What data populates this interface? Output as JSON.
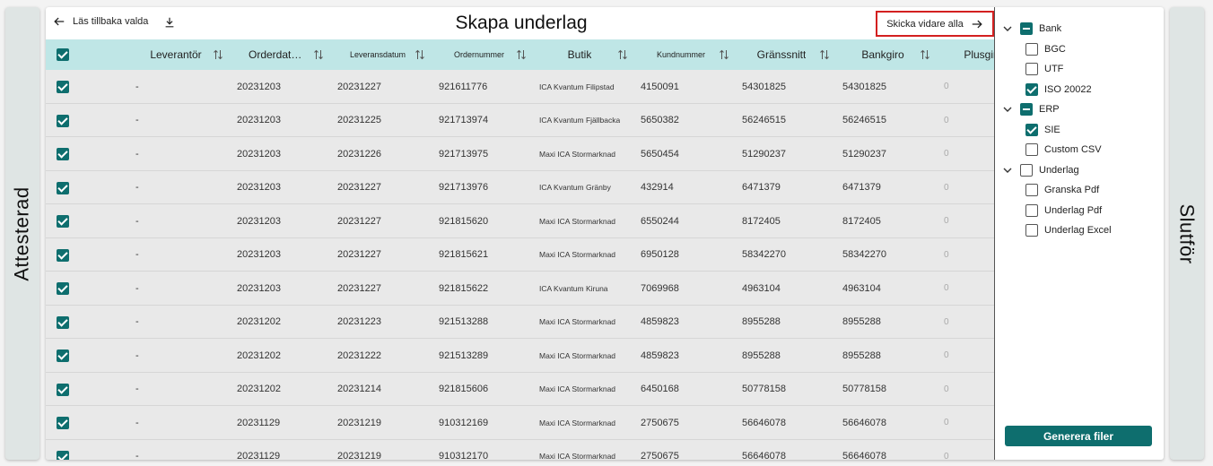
{
  "left_panel": {
    "label": "Attesterad"
  },
  "right_panel": {
    "label": "Slutför"
  },
  "toolbar": {
    "back_label": "Läs tillbaka valda",
    "title": "Skapa underlag",
    "forward_label": "Skicka vidare alla"
  },
  "table": {
    "columns": [
      {
        "label": "Leverantör",
        "sortable": true
      },
      {
        "label": "Orderdatum",
        "sortable": true
      },
      {
        "label": "Leveransdatum",
        "sortable": true
      },
      {
        "label": "Ordernummer",
        "sortable": true
      },
      {
        "label": "Butik",
        "sortable": true
      },
      {
        "label": "Kundnummer",
        "sortable": true
      },
      {
        "label": "Gränssnitt",
        "sortable": true
      },
      {
        "label": "Bankgiro",
        "sortable": true
      },
      {
        "label": "Plusgiro",
        "sortable": true
      }
    ],
    "rows": [
      {
        "checked": true,
        "cells": [
          "-",
          "20231203",
          "20231227",
          "921611776",
          "ICA Kvantum Filipstad",
          "4150091",
          "54301825",
          "54301825",
          "0"
        ]
      },
      {
        "checked": true,
        "cells": [
          "-",
          "20231203",
          "20231225",
          "921713974",
          "ICA Kvantum Fjällbacka",
          "5650382",
          "56246515",
          "56246515",
          "0"
        ]
      },
      {
        "checked": true,
        "cells": [
          "-",
          "20231203",
          "20231226",
          "921713975",
          "Maxi ICA Stormarknad",
          "5650454",
          "51290237",
          "51290237",
          "0"
        ]
      },
      {
        "checked": true,
        "cells": [
          "-",
          "20231203",
          "20231227",
          "921713976",
          "ICA Kvantum Gränby",
          "432914",
          "6471379",
          "6471379",
          "0"
        ]
      },
      {
        "checked": true,
        "cells": [
          "-",
          "20231203",
          "20231227",
          "921815620",
          "Maxi ICA Stormarknad",
          "6550244",
          "8172405",
          "8172405",
          "0"
        ]
      },
      {
        "checked": true,
        "cells": [
          "-",
          "20231203",
          "20231227",
          "921815621",
          "Maxi ICA Stormarknad",
          "6950128",
          "58342270",
          "58342270",
          "0"
        ]
      },
      {
        "checked": true,
        "cells": [
          "-",
          "20231203",
          "20231227",
          "921815622",
          "ICA Kvantum Kiruna",
          "7069968",
          "4963104",
          "4963104",
          "0"
        ]
      },
      {
        "checked": true,
        "cells": [
          "-",
          "20231202",
          "20231223",
          "921513288",
          "Maxi ICA Stormarknad",
          "4859823",
          "8955288",
          "8955288",
          "0"
        ]
      },
      {
        "checked": true,
        "cells": [
          "-",
          "20231202",
          "20231222",
          "921513289",
          "Maxi ICA Stormarknad",
          "4859823",
          "8955288",
          "8955288",
          "0"
        ]
      },
      {
        "checked": true,
        "cells": [
          "-",
          "20231202",
          "20231214",
          "921815606",
          "Maxi ICA Stormarknad",
          "6450168",
          "50778158",
          "50778158",
          "0"
        ]
      },
      {
        "checked": true,
        "cells": [
          "-",
          "20231129",
          "20231219",
          "910312169",
          "Maxi ICA Stormarknad",
          "2750675",
          "56646078",
          "56646078",
          "0"
        ]
      },
      {
        "checked": true,
        "cells": [
          "-",
          "20231129",
          "20231219",
          "910312170",
          "Maxi ICA Stormarknad",
          "2750675",
          "56646078",
          "56646078",
          "0"
        ]
      }
    ]
  },
  "tree": [
    {
      "label": "Bank",
      "level": 0,
      "state": "indeterminate",
      "expanded": true
    },
    {
      "label": "BGC",
      "level": 1,
      "state": "unchecked"
    },
    {
      "label": "UTF",
      "level": 1,
      "state": "unchecked"
    },
    {
      "label": "ISO 20022",
      "level": 1,
      "state": "checked"
    },
    {
      "label": "ERP",
      "level": 0,
      "state": "indeterminate",
      "expanded": true
    },
    {
      "label": "SIE",
      "level": 1,
      "state": "checked"
    },
    {
      "label": "Custom CSV",
      "level": 1,
      "state": "unchecked"
    },
    {
      "label": "Underlag",
      "level": 0,
      "state": "unchecked",
      "expanded": true
    },
    {
      "label": "Granska Pdf",
      "level": 1,
      "state": "unchecked"
    },
    {
      "label": "Underlag Pdf",
      "level": 1,
      "state": "unchecked"
    },
    {
      "label": "Underlag Excel",
      "level": 1,
      "state": "unchecked"
    }
  ],
  "generate_button": {
    "label": "Generera filer"
  },
  "colors": {
    "accent": "#0e6e6e",
    "header_bg": "#bfe6e6",
    "highlight_border": "#d32020",
    "side_panel": "#dfe5e4"
  }
}
